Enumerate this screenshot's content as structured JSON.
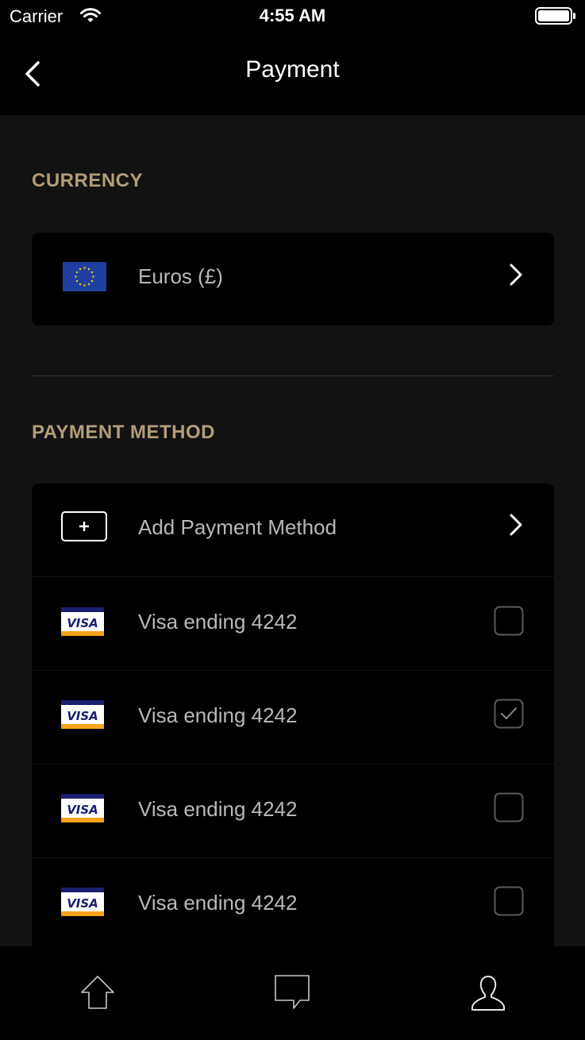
{
  "status_bar": {
    "carrier": "Carrier",
    "time": "4:55 AM"
  },
  "nav": {
    "title": "Payment",
    "back_icon": "chevron-left-icon"
  },
  "currency_section": {
    "header": "CURRENCY",
    "selected": {
      "label": "Euros (£)",
      "icon": "eu-flag-icon"
    }
  },
  "payment_section": {
    "header": "PAYMENT METHOD",
    "add_label": "Add Payment Method",
    "cards": [
      {
        "label": "Visa ending 4242",
        "brand": "VISA",
        "checked": false
      },
      {
        "label": "Visa ending 4242",
        "brand": "VISA",
        "checked": true
      },
      {
        "label": "Visa ending 4242",
        "brand": "VISA",
        "checked": false
      },
      {
        "label": "Visa ending 4242",
        "brand": "VISA",
        "checked": false
      }
    ]
  },
  "tab_bar": {
    "items": [
      "home-icon",
      "chat-icon",
      "profile-icon"
    ]
  },
  "colors": {
    "accent": "#b39d7a",
    "background": "#121212",
    "card": "#000000",
    "text_secondary": "#b8b8b8",
    "eu_blue": "#1f3fa0",
    "eu_star": "#f2d000",
    "visa_blue": "#1a1f71",
    "visa_orange": "#f7a21b"
  }
}
